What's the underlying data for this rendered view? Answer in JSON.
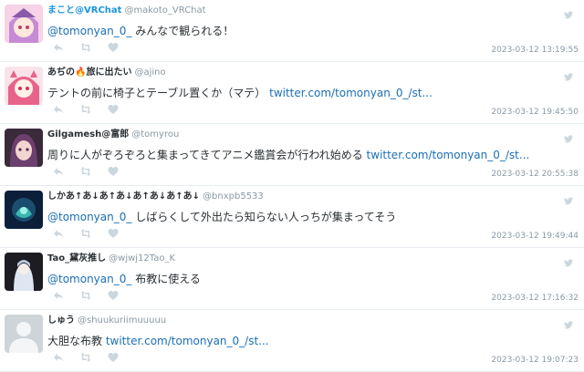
{
  "tweets": [
    {
      "name": "まこと@VRChat",
      "handle": "@makoto_VRChat",
      "mention": "@tomonyan_0_",
      "text": " みんなで観られる！",
      "link": "",
      "time": "2023-03-12 13:19:55"
    },
    {
      "name": "あぢの🔥旅に出たい",
      "handle": "@ajino",
      "mention": "",
      "text": "テントの前に椅子とテーブル置くか（マテ） ",
      "link": "twitter.com/tomonyan_0_/st...",
      "time": "2023-03-12 19:45:50"
    },
    {
      "name": "Gilgamesh@富郎",
      "handle": "@tomyrou",
      "mention": "",
      "text": "周りに人がぞろぞろと集まってきてアニメ鑑賞会が行われ始める ",
      "link": "twitter.com/tomonyan_0_/st...",
      "time": "2023-03-12 20:55:38"
    },
    {
      "name": "しかあ↑あ↓あ↑あ↓あ↑あ↓あ↑あ↓",
      "handle": "@bnxpb5533",
      "mention": "@tomonyan_0_",
      "text": " しばらくして外出たら知らない人っちが集まってそう",
      "link": "",
      "time": "2023-03-12 19:49:44"
    },
    {
      "name": "Tao_黛灰推し",
      "handle": "@wjwj12Tao_K",
      "mention": "@tomonyan_0_",
      "text": " 布教に使える",
      "link": "",
      "time": "2023-03-12 17:16:32"
    },
    {
      "name": "しゅう",
      "handle": "@shuukuriimuuuuu",
      "mention": "",
      "text": "大胆な布教 ",
      "link": "twitter.com/tomonyan_0_/st...",
      "time": "2023-03-12 19:07:23"
    }
  ],
  "icons": [
    "reply-icon",
    "retweet-icon",
    "like-icon",
    "twitter-bird-icon"
  ],
  "colors": {
    "name_highlight": "#1b95e0",
    "link": "#1b6fb5",
    "meta": "#8899a6",
    "divider": "#e6ecf0"
  }
}
